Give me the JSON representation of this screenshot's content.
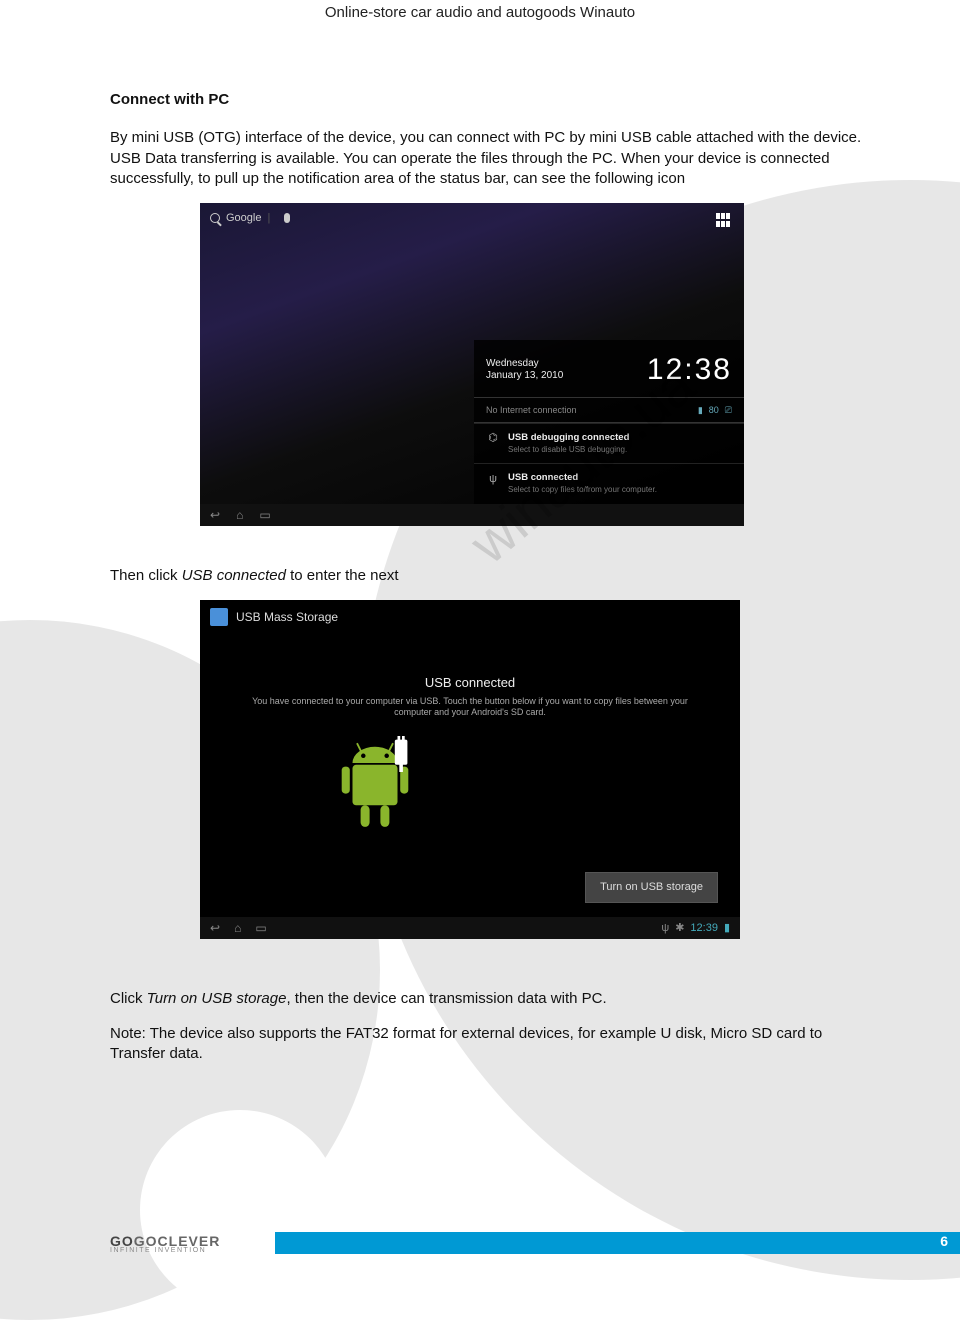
{
  "header": "Online-store car audio and autogoods Winauto",
  "section_title": "Connect with PC",
  "para1": "By mini USB (OTG) interface of the device, you can connect with PC by mini USB cable attached with the device. USB Data transferring is available. You can operate the files through the PC. When your device is connected successfully, to pull up the notification area of the status bar, can see the following icon",
  "watermark": "winauto.ua",
  "shot1": {
    "search_label": "Google",
    "date_day": "Wednesday",
    "date_full": "January 13, 2010",
    "clock": "12:38",
    "conn_text": "No Internet connection",
    "conn_batt": "80",
    "notif1_title": "USB debugging connected",
    "notif1_sub": "Select to disable USB debugging.",
    "notif2_title": "USB connected",
    "notif2_sub": "Select to copy files to/from your computer."
  },
  "mid_text_pre": "Then click ",
  "mid_text_em": "USB connected",
  "mid_text_post": " to enter the next",
  "shot2": {
    "window_title": "USB Mass Storage",
    "heading": "USB connected",
    "sub": "You have connected to your computer via USB. Touch the button below if you want to copy files between your computer and your Android's SD card.",
    "button": "Turn on USB storage",
    "status_time": "12:39"
  },
  "para_end_pre": "Click  ",
  "para_end_em": "Turn on USB storage",
  "para_end_post": ", then the device can transmission data with PC.",
  "note": "Note: The device also supports the FAT32 format for external devices, for example U disk, Micro SD card to Transfer data.",
  "footer": {
    "brand1": "GO",
    "brand2": "GOCLEVER",
    "brand_sub": "INFINITE INVENTION",
    "page": "6"
  }
}
